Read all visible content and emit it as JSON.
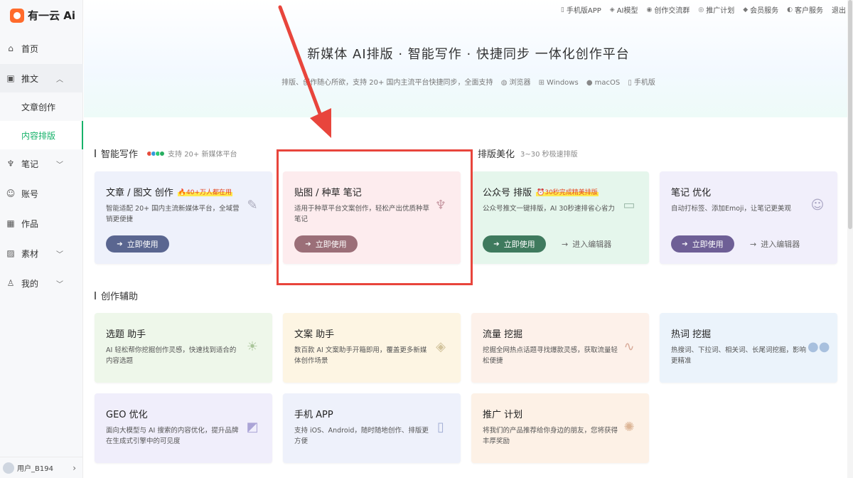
{
  "app": {
    "name": "有一云",
    "name_suffix": "Ai"
  },
  "sidebar": {
    "items": [
      {
        "label": "首页",
        "icon": "home-icon"
      },
      {
        "label": "推文",
        "icon": "edit-icon",
        "expanded": true
      },
      {
        "label": "笔记",
        "icon": "sprout-icon"
      },
      {
        "label": "账号",
        "icon": "user-group-icon"
      },
      {
        "label": "作品",
        "icon": "grid-icon"
      },
      {
        "label": "素材",
        "icon": "image-icon"
      },
      {
        "label": "我的",
        "icon": "person-icon"
      }
    ],
    "sub_items": [
      {
        "label": "文章创作",
        "active": false
      },
      {
        "label": "内容排版",
        "active": true
      }
    ],
    "user": {
      "name": "用户_B194"
    }
  },
  "top_links": [
    "手机版APP",
    "AI模型",
    "创作交流群",
    "推广计划",
    "会员服务",
    "客户服务",
    "退出"
  ],
  "hero": {
    "title": "新媒体 AI排版 · 智能写作 · 快捷同步 一体化创作平台",
    "subtitle": "排版、创作随心所欲，支持 20+ 国内主流平台快捷同步，全面支持",
    "platforms": [
      "浏览器",
      "Windows",
      "macOS",
      "手机版"
    ]
  },
  "sections": {
    "writing": {
      "title": "智能写作",
      "hint": "支持 20+ 新媒体平台"
    },
    "layout": {
      "title": "排版美化",
      "hint": "3~30 秒极速排版"
    },
    "assist": {
      "title": "创作辅助"
    }
  },
  "cards_row1": [
    {
      "title": "文章 / 图文 创作",
      "badge": "🔥40+万人都在用",
      "desc": "智能适配 20+ 国内主流新媒体平台，全域营销更便捷",
      "button": "立即使用",
      "color": "#eef1fb",
      "btn_color": "#5a6690",
      "icon": "note-icon"
    },
    {
      "title": "贴图 / 种草 笔记",
      "badge": "",
      "desc": "适用于种草平台文案创作，轻松产出优质种草笔记",
      "button": "立即使用",
      "color": "#fdecee",
      "btn_color": "#9b6f78",
      "icon": "sprout-icon"
    },
    {
      "title": "公众号 排版",
      "badge": "⏰30秒完成精美排版",
      "desc": "公众号推文一键排版，AI 30秒速排省心省力",
      "button": "立即使用",
      "link": "进入编辑器",
      "color": "#e5f6ec",
      "btn_color": "#3f7a5e",
      "icon": "monitor-icon"
    },
    {
      "title": "笔记 优化",
      "badge": "",
      "desc": "自动打标签、添加Emoji，让笔记更美观",
      "button": "立即使用",
      "link": "进入编辑器",
      "color": "#f1effb",
      "btn_color": "#6e5f96",
      "icon": "smile-icon"
    }
  ],
  "cards_row2": [
    {
      "title": "选题 助手",
      "desc": "AI 轻松帮你挖掘创作灵感，快速找到适合的内容选题",
      "color": "#eef7ea",
      "icon": "bulb-icon"
    },
    {
      "title": "文案 助手",
      "desc": "数百款 AI 文案助手开箱即用，覆盖更多新媒体创作场景",
      "color": "#fdf5e3",
      "icon": "layers-icon"
    },
    {
      "title": "流量 挖掘",
      "desc": "挖掘全网热点话题寻找爆款灵感，获取流量轻松便捷",
      "color": "#fdf1ea",
      "icon": "pulse-icon"
    },
    {
      "title": "热词 挖掘",
      "desc": "热搜词、下拉词、相关词、长尾词挖掘，影响更精准",
      "color": "#ebf3fb",
      "icon": "dots-icon"
    }
  ],
  "cards_row3": [
    {
      "title": "GEO 优化",
      "desc": "面向大模型与 AI 搜索的内容优化，提升品牌在生成式引擎中的可见度",
      "color": "#f0eefb",
      "icon": "chart-icon"
    },
    {
      "title": "手机 APP",
      "desc": "支持 iOS、Android，随时随地创作、排版更方便",
      "color": "#eef1fb",
      "icon": "phone-icon"
    },
    {
      "title": "推广 计划",
      "desc": "将我们的产品推荐给你身边的朋友，您将获得丰厚奖励",
      "color": "#fdf1e6",
      "icon": "reward-icon"
    }
  ],
  "colors": {
    "accent": "#17b26a",
    "annotation": "#e8453c"
  }
}
